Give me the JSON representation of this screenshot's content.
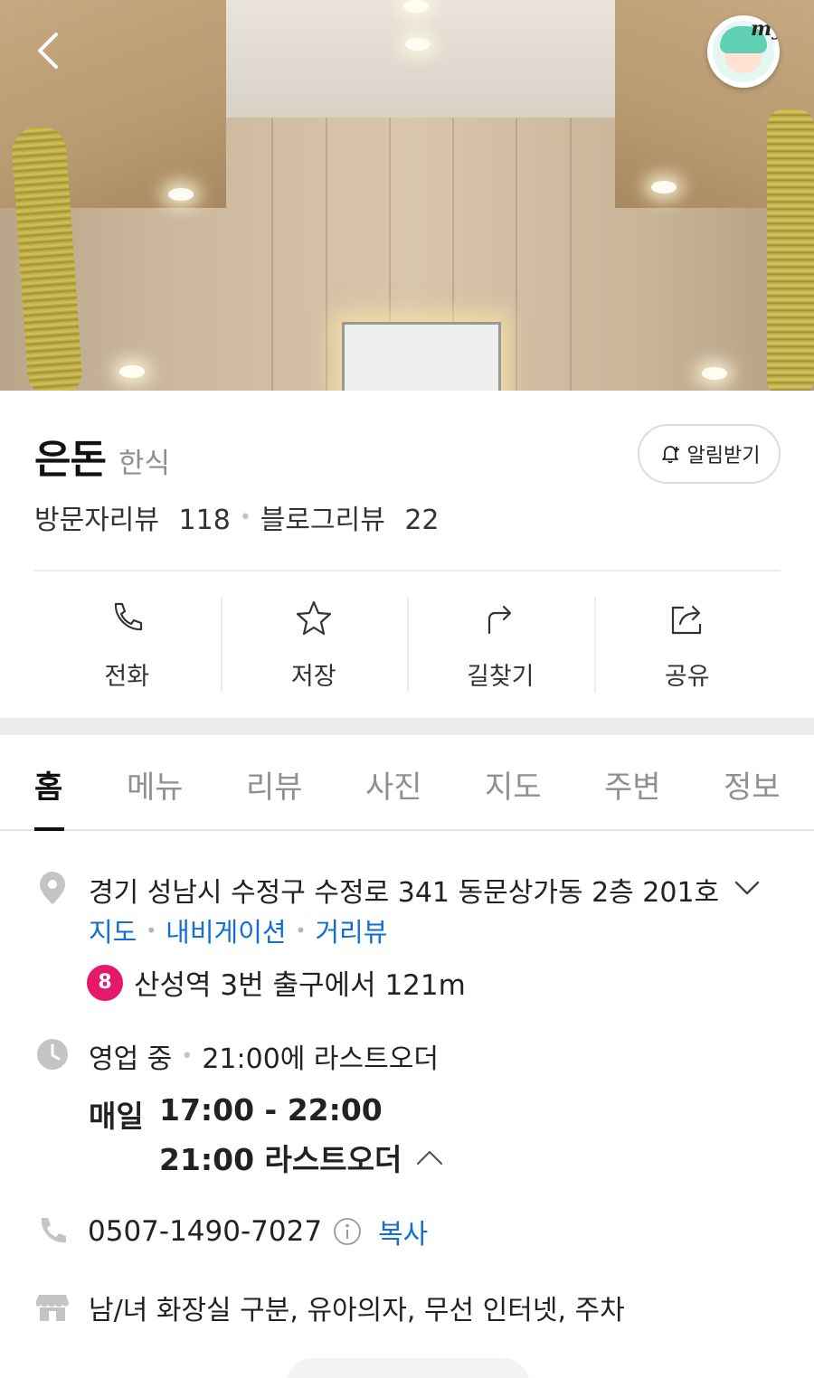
{
  "header": {
    "back_icon": "chevron-left-icon",
    "profile_label": "my"
  },
  "place": {
    "name": "은돈",
    "category": "한식",
    "alarm_label": "알림받기",
    "visitor_reviews_label": "방문자리뷰",
    "visitor_reviews_count": "118",
    "blog_reviews_label": "블로그리뷰",
    "blog_reviews_count": "22"
  },
  "actions": [
    {
      "label": "전화",
      "icon": "phone-icon"
    },
    {
      "label": "저장",
      "icon": "star-icon"
    },
    {
      "label": "길찾기",
      "icon": "directions-icon"
    },
    {
      "label": "공유",
      "icon": "share-icon"
    }
  ],
  "tabs": [
    "홈",
    "메뉴",
    "리뷰",
    "사진",
    "지도",
    "주변",
    "정보"
  ],
  "active_tab": "홈",
  "info": {
    "address": "경기 성남시 수정구 수정로 341 동문상가동 2층 201호",
    "address_links": [
      "지도",
      "내비게이션",
      "거리뷰"
    ],
    "subway_line": "8",
    "subway_line_color": "#e6186c",
    "subway_text": "산성역 3번 출구에서 121m",
    "open_status": "영업 중",
    "last_order_note": "21:00에 라스트오더",
    "hours_day": "매일",
    "hours_range": "17:00 - 22:00",
    "hours_last_order": "21:00 라스트오더",
    "phone": "0507-1490-7027",
    "copy_label": "복사",
    "amenities": "남/녀 화장실 구분, 유아의자, 무선 인터넷, 주차"
  },
  "colors": {
    "link_blue": "#0f6fd6",
    "text_dark": "#222222",
    "muted": "#909090"
  }
}
